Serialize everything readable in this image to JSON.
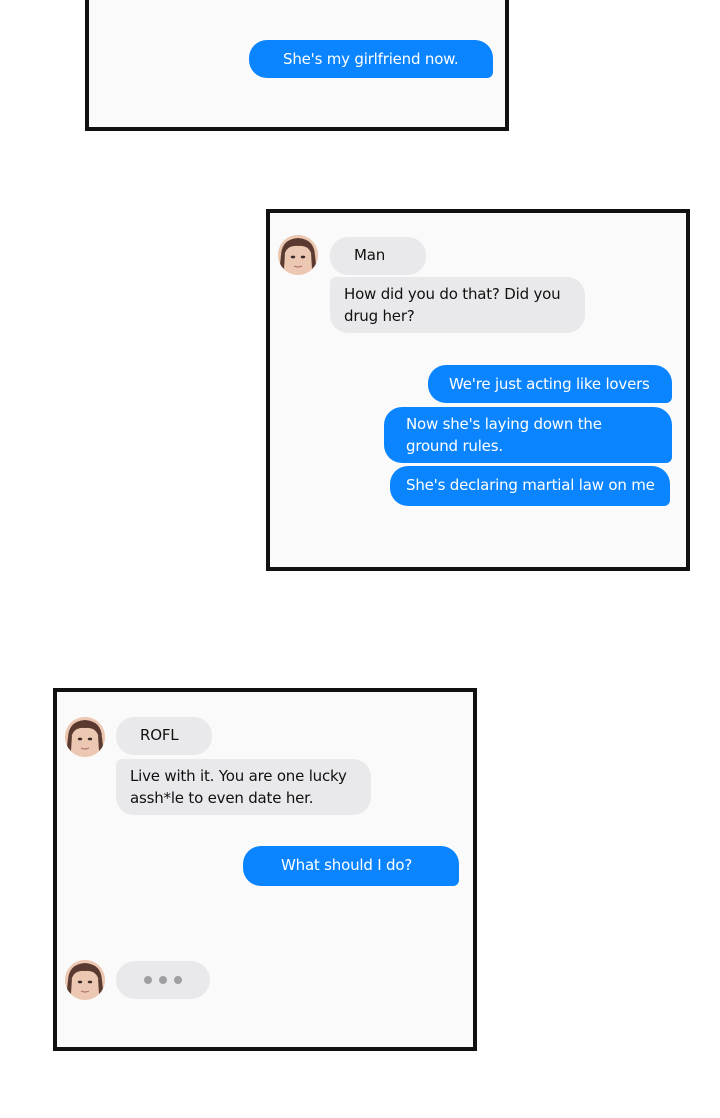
{
  "colors": {
    "outgoing_bubble": "#0a84ff",
    "incoming_bubble": "#e9e9eb",
    "panel_border": "#111111",
    "panel_background": "#fafafa"
  },
  "panels": [
    {
      "messages": [
        {
          "side": "outgoing",
          "text": "She's my girlfriend now."
        }
      ]
    },
    {
      "contact": {
        "avatar_icon": "contact-avatar-icon",
        "name": "Man"
      },
      "messages": [
        {
          "side": "incoming",
          "text": "How did you do that? Did you drug her?"
        },
        {
          "side": "outgoing",
          "text": "We're just acting like lovers"
        },
        {
          "side": "outgoing",
          "text": "Now she's laying down the ground rules."
        },
        {
          "side": "outgoing",
          "text": "She's declaring martial law on me"
        }
      ]
    },
    {
      "contact": {
        "avatar_icon": "contact-avatar-icon",
        "name": "ROFL"
      },
      "messages": [
        {
          "side": "incoming",
          "text": "Live with it. You are one lucky assh*le to even date her."
        },
        {
          "side": "outgoing",
          "text": "What should I do?"
        }
      ],
      "typing_indicator": {
        "icon": "typing-dots-icon"
      }
    }
  ]
}
